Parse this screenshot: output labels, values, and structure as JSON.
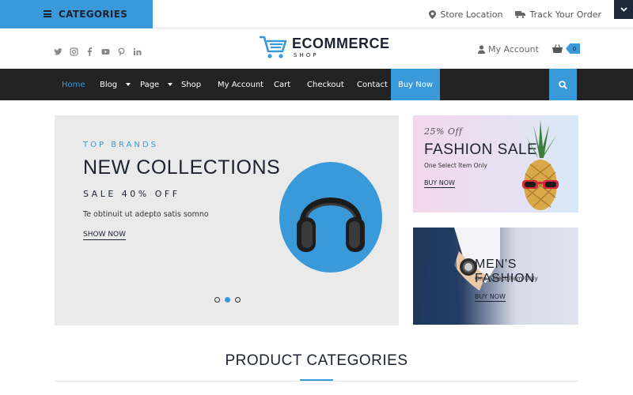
{
  "topbar": {
    "categories_label": "CATEGORIES",
    "store_location": "Store Location",
    "track_order": "Track Your Order"
  },
  "header": {
    "social_icons": [
      "twitter-icon",
      "instagram-icon",
      "facebook-icon",
      "youtube-icon",
      "pinterest-icon",
      "linkedin-icon"
    ],
    "logo_word": "ECOMMERCE",
    "logo_sub": "SHOP",
    "account_label": "My Account",
    "cart_count": "0"
  },
  "nav": {
    "items": [
      "Home",
      "Blog",
      "Page",
      "Shop",
      "My Account",
      "Cart",
      "Checkout",
      "Contact"
    ],
    "buy_now": "Buy Now"
  },
  "hero": {
    "eyebrow": "TOP BRANDS",
    "title": "NEW COLLECTIONS",
    "sale": "SALE 40% OFF",
    "description": "Te obtinuit ut adepto satis somno",
    "cta": "SHOW NOW",
    "slides": 3,
    "active_slide": 2
  },
  "promos": [
    {
      "script": "25% Off",
      "title": "FASHION SALE",
      "desc": "One Select Item Only",
      "cta": "BUY NOW"
    },
    {
      "title": "MEN'S FASHION",
      "desc": "One Select Item Only",
      "cta": "BUY NOW"
    }
  ],
  "section": {
    "title": "PRODUCT CATEGORIES"
  },
  "colors": {
    "accent": "#3a9ad9",
    "dark": "#1c2230",
    "nav_bg": "#232323"
  }
}
